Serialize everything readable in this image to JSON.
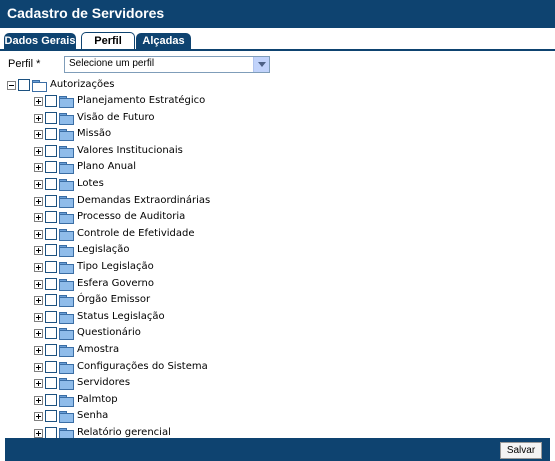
{
  "header": {
    "title": "Cadastro de Servidores"
  },
  "tabs": [
    {
      "label": "Dados Gerais",
      "active": false
    },
    {
      "label": "Perfil",
      "active": true
    },
    {
      "label": "Alçadas",
      "active": false
    }
  ],
  "perfil": {
    "label": "Perfil *",
    "select_value": "Selecione um perfil"
  },
  "tree": {
    "root_label": "Autorizações",
    "items": [
      "Planejamento Estratégico",
      "Visão de Futuro",
      "Missão",
      "Valores Institucionais",
      "Plano Anual",
      "Lotes",
      "Demandas Extraordinárias",
      "Processo de Auditoria",
      "Controle de Efetividade",
      "Legislação",
      "Tipo Legislação",
      "Esfera Governo",
      "Órgão Emissor",
      "Status Legislação",
      "Questionário",
      "Amostra",
      "Configurações do Sistema",
      "Servidores",
      "Palmtop",
      "Senha",
      "Relatório gerencial"
    ]
  },
  "footer": {
    "save_label": "Salvar"
  },
  "colors": {
    "header_bg": "#0e4370",
    "tab_bg": "#0e4370"
  }
}
